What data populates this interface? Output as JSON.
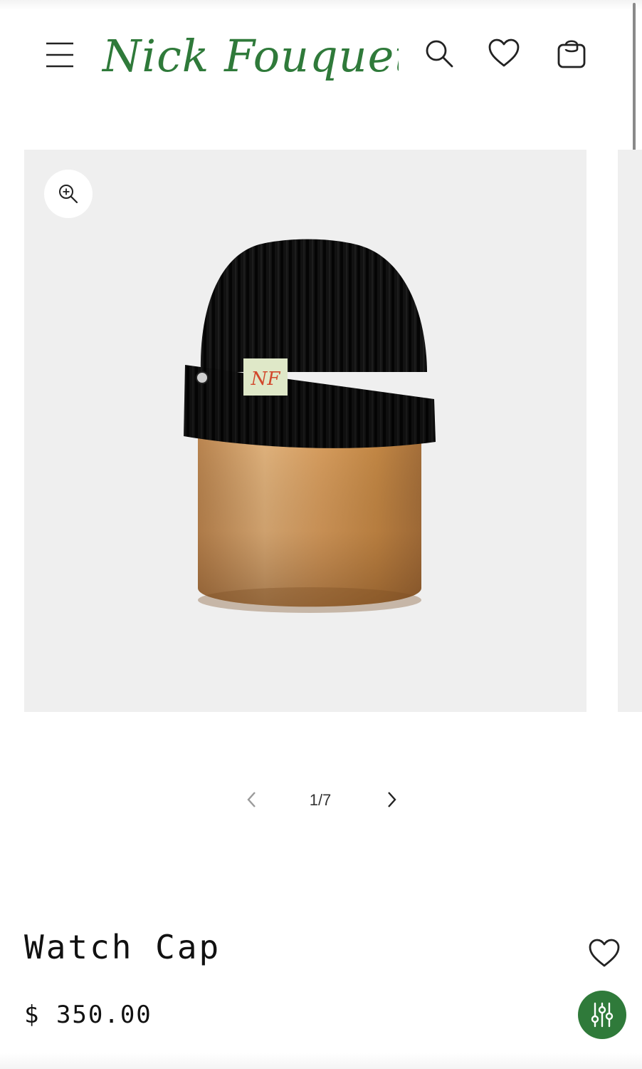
{
  "brand": {
    "logo_text": "Nick Fouquet",
    "color": "#2f7a3a"
  },
  "header": {
    "icons": [
      "menu-icon",
      "search-icon",
      "heart-icon",
      "shopping-bag-icon"
    ]
  },
  "gallery": {
    "current": "1/7",
    "zoom_icon": "zoom-in-icon",
    "background": "#efefef"
  },
  "product": {
    "title": "Watch Cap",
    "price": "$ 350.00",
    "patch_text": "NF"
  },
  "fab": {
    "icon": "filter-sliders-icon",
    "color": "#2f7a3a"
  }
}
